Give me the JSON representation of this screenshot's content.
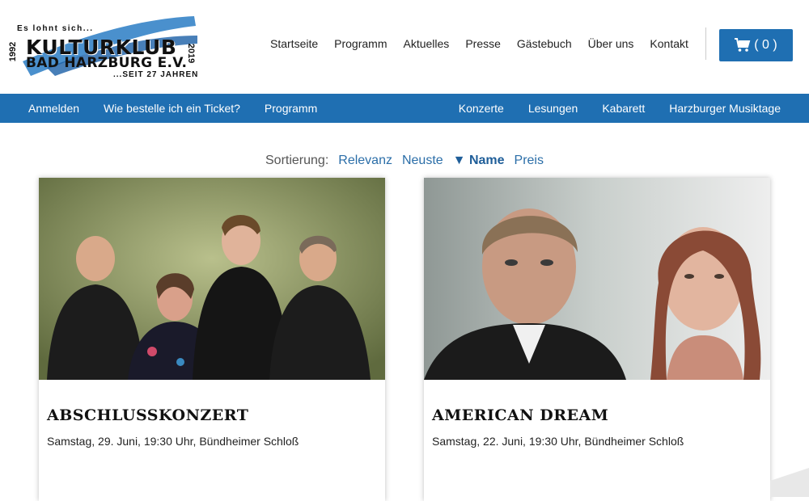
{
  "logo": {
    "tagline_top": "Es lohnt sich...",
    "brand": "KULTURKLUB",
    "sub": "BAD HARZBURG E.V.",
    "tagline_bottom": "...SEIT 27 JAHREN",
    "year_left": "1992",
    "year_right": "2019"
  },
  "topnav": [
    "Startseite",
    "Programm",
    "Aktuelles",
    "Presse",
    "Gästebuch",
    "Über uns",
    "Kontakt"
  ],
  "cart": {
    "label": "( 0 )",
    "icon": "shopping-cart-icon"
  },
  "subnav": {
    "left": [
      "Anmelden",
      "Wie bestelle ich ein Ticket?",
      "Programm"
    ],
    "right": [
      "Konzerte",
      "Lesungen",
      "Kabarett",
      "Harzburger Musiktage"
    ]
  },
  "sort": {
    "label": "Sortierung:",
    "options": [
      "Relevanz",
      "Neuste",
      "▼ Name",
      "Preis"
    ],
    "active": "▼ Name"
  },
  "events": [
    {
      "title": "ABSCHLUSSKONZERT",
      "meta": "Samstag, 29. Juni, 19:30 Uhr, Bündheimer Schloß"
    },
    {
      "title": "AMERICAN DREAM",
      "meta": "Samstag, 22. Juni, 19:30 Uhr, Bündheimer Schloß"
    }
  ],
  "colors": {
    "primary": "#1f6fb2",
    "link": "#2b6ea8"
  }
}
